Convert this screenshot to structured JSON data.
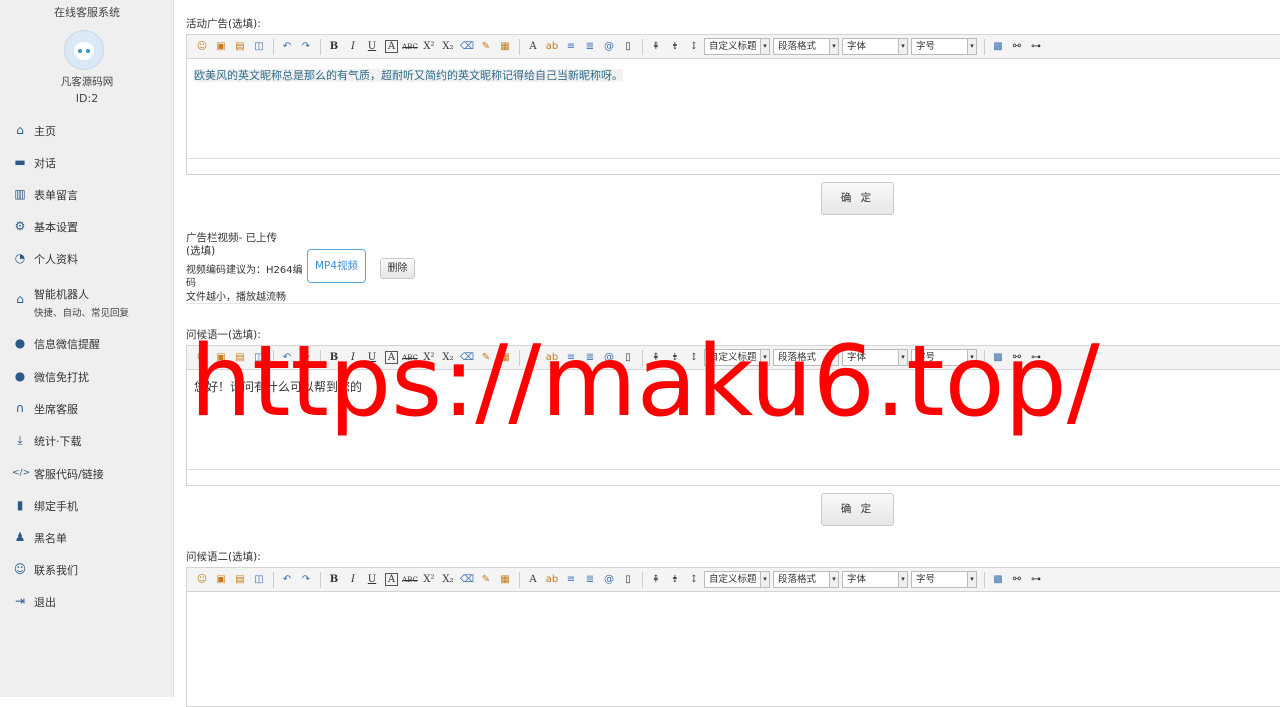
{
  "sidebar": {
    "system_title": "在线客服系统",
    "user_name": "凡客源码网",
    "user_id": "ID:2",
    "items": [
      {
        "label": "主页",
        "icon": "home-icon",
        "glyph": "⌂"
      },
      {
        "label": "对话",
        "icon": "chat-icon",
        "glyph": "▬"
      },
      {
        "label": "表单留言",
        "icon": "book-icon",
        "glyph": "▥"
      },
      {
        "label": "基本设置",
        "icon": "gear-icon",
        "glyph": "⚙"
      },
      {
        "label": "个人资料",
        "icon": "profile-icon",
        "glyph": "◔"
      },
      {
        "label": "智能机器人",
        "sub": "快捷、自动、常见回复",
        "icon": "robot-icon",
        "glyph": "⌂"
      },
      {
        "label": "信息微信提醒",
        "icon": "wechat-icon",
        "glyph": "●"
      },
      {
        "label": "微信免打扰",
        "icon": "wechat-mute-icon",
        "glyph": "●"
      },
      {
        "label": "坐席客服",
        "icon": "headset-icon",
        "glyph": "∩"
      },
      {
        "label": "统计·下载",
        "icon": "download-icon",
        "glyph": "⤓"
      },
      {
        "label": "客服代码/链接",
        "icon": "code-icon",
        "glyph": "</>"
      },
      {
        "label": "绑定手机",
        "icon": "phone-icon",
        "glyph": "▮"
      },
      {
        "label": "黑名单",
        "icon": "blacklist-icon",
        "glyph": "♟"
      },
      {
        "label": "联系我们",
        "icon": "contact-icon",
        "glyph": "☺"
      },
      {
        "label": "退出",
        "icon": "logout-icon",
        "glyph": "⇥"
      }
    ]
  },
  "toolbar": {
    "bold": "B",
    "italic": "I",
    "underline": "U",
    "font_border": "A",
    "strike": "ABC",
    "sup": "X²",
    "sub": "X₂",
    "font_color": "A",
    "custom_heading": "自定义标题",
    "paragraph_format": "段落格式",
    "font_family": "字体",
    "font_size": "字号"
  },
  "editors": [
    {
      "label": "活动广告(选填):",
      "content": "欧美风的英文昵称总是那么的有气质，超耐听又简约的英文昵称记得给自己当新昵称呀。"
    },
    {
      "label": "问候语一(选填):",
      "content": "您好！请问有什么可以帮到您的"
    },
    {
      "label": "问候语二(选填):",
      "content": ""
    }
  ],
  "confirm_label": "确 定",
  "video": {
    "title": "广告栏视频- 已上传",
    "optional": "(选填)",
    "hint1": "视频编码建议为：H264编",
    "hint2": "码",
    "hint3": "文件越小，播放越流畅",
    "mp4_label": "MP4视频",
    "delete_label": "删除"
  },
  "watermark": "https://maku6.top/"
}
